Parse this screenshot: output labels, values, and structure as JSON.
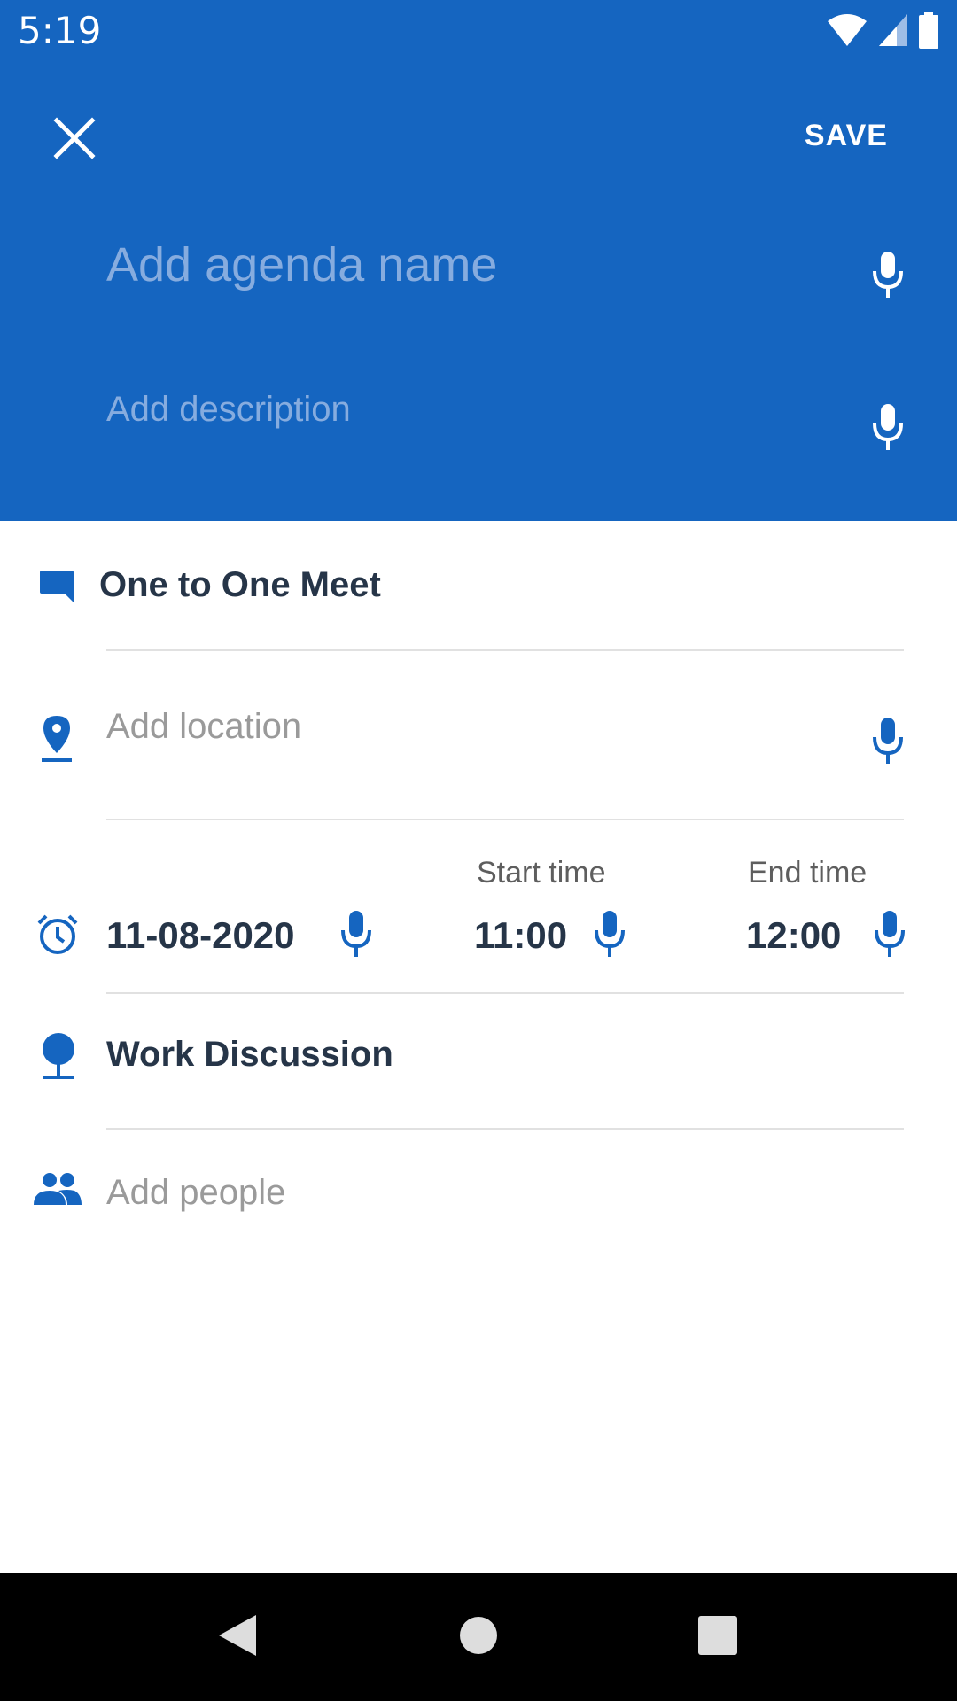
{
  "status_bar": {
    "time": "5:19",
    "icons": [
      "wifi-icon",
      "cell-signal-icon",
      "battery-icon"
    ]
  },
  "toolbar": {
    "close_icon": "close-icon",
    "save_label": "SAVE"
  },
  "form": {
    "agenda_name_placeholder": "Add agenda name",
    "description_placeholder": "Add description",
    "meeting_type": "One to One Meet",
    "location_placeholder": "Add location",
    "date": "11-08-2020",
    "start_time_label": "Start time",
    "start_time": "11:00",
    "end_time_label": "End time",
    "end_time": "12:00",
    "topic": "Work Discussion",
    "people_placeholder": "Add people"
  },
  "colors": {
    "primary": "#1565C0",
    "header_placeholder": "#86ACDF",
    "text_dark": "#263548",
    "placeholder_gray": "#9A9A9A",
    "divider": "#E1E1E1"
  },
  "nav": {
    "icons": [
      "back-icon",
      "home-icon",
      "recents-icon"
    ]
  }
}
